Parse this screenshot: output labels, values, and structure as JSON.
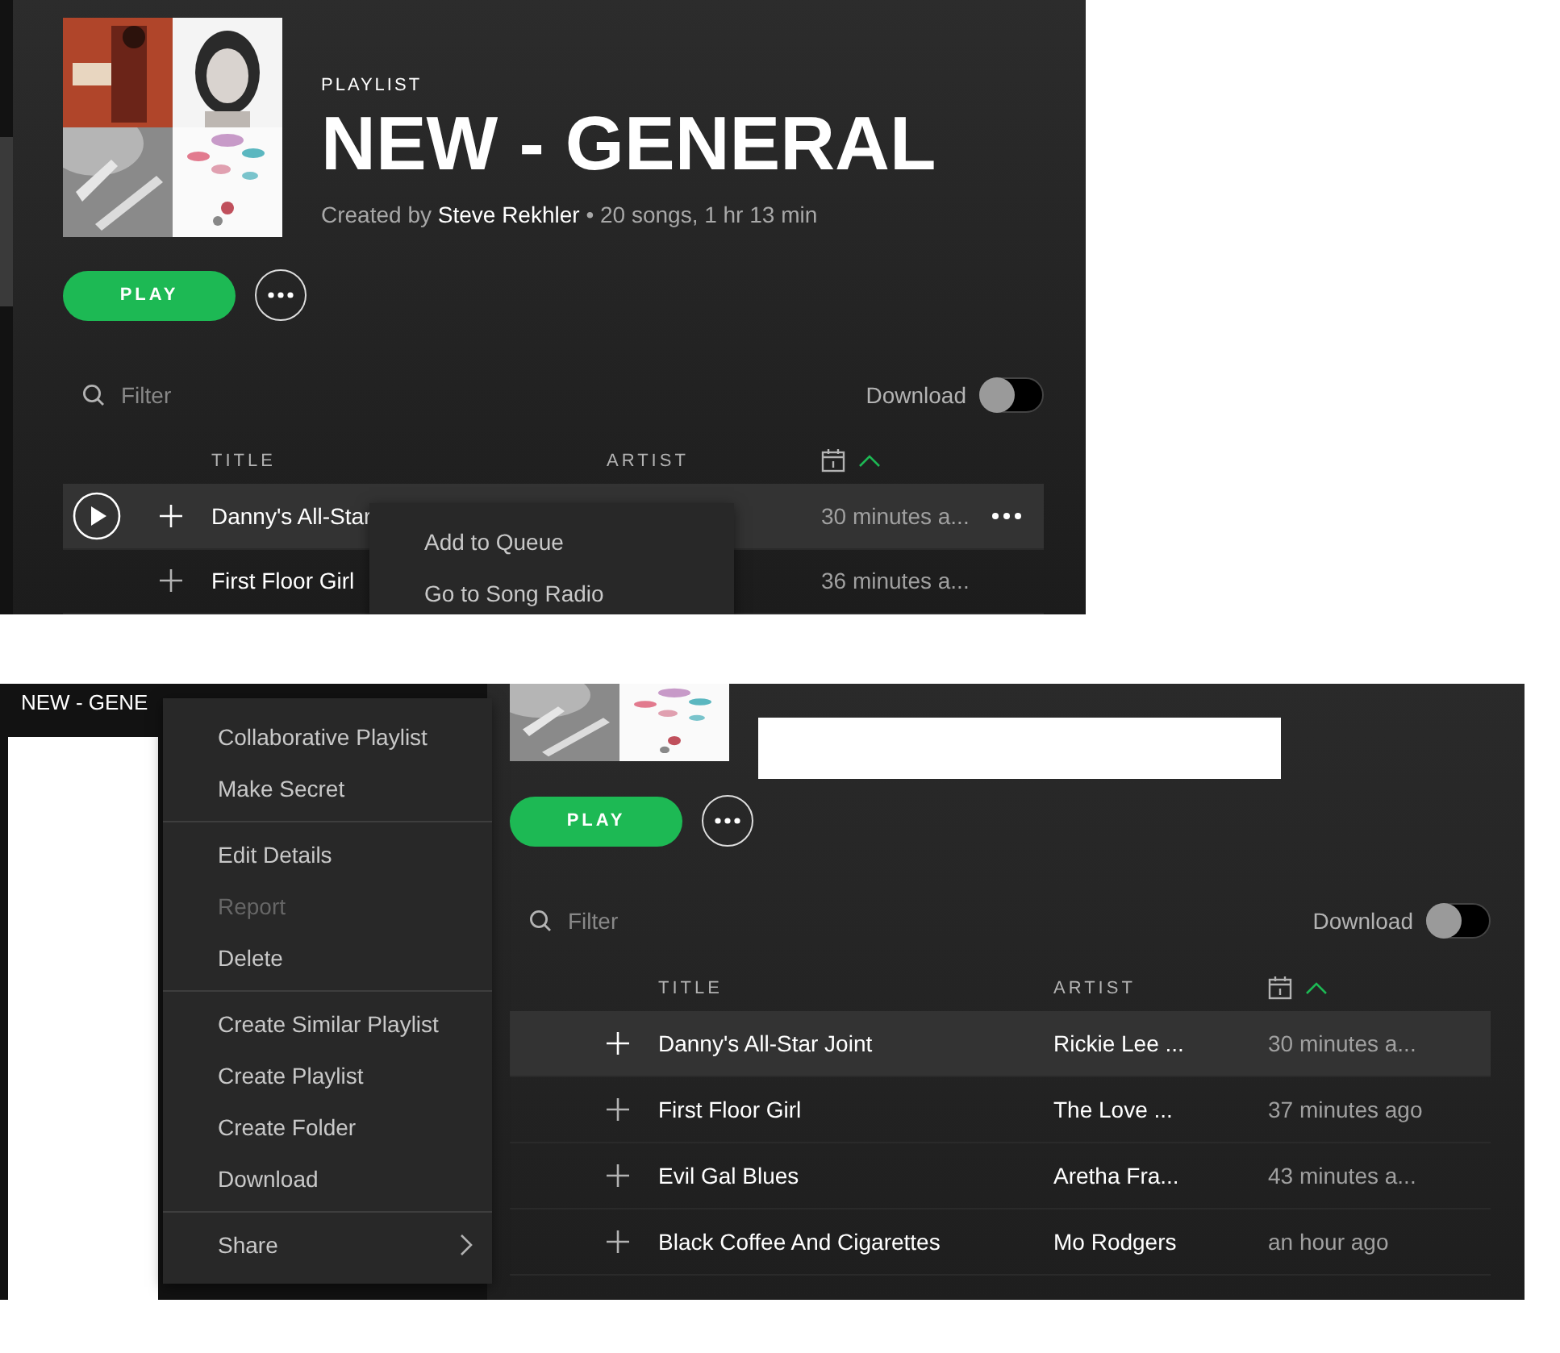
{
  "top_screenshot": {
    "header": {
      "type_label": "PLAYLIST",
      "title": "NEW - GENERAL",
      "meta": "Created by **Steve Rekhler** • 20 songs, 1 hr 13 min"
    },
    "play_button": "PLAY",
    "filter": {
      "placeholder": "Filter"
    },
    "download": {
      "label": "Download",
      "on": false
    },
    "columns": [
      "TITLE",
      "ARTIST"
    ],
    "rows": [
      {
        "title": "Danny's All-Star",
        "added": "30 minutes a...",
        "selected": true,
        "hover_controls": true
      },
      {
        "title": "First Floor Girl",
        "added": "36 minutes a...",
        "selected": false,
        "hover_controls": false
      }
    ],
    "context_menu": {
      "sections": [
        [
          {
            "label": "Add to Queue",
            "disabled": false
          },
          {
            "label": "Go to Song Radio",
            "disabled": false
          }
        ]
      ]
    }
  },
  "bottom_screenshot": {
    "sidebar": {
      "playlist_label": "NEW - GENE"
    },
    "play_button": "PLAY",
    "filter": {
      "placeholder": "Filter"
    },
    "download": {
      "label": "Download",
      "on": false
    },
    "columns": [
      "TITLE",
      "ARTIST"
    ],
    "rows": [
      {
        "title": "Danny's All-Star Joint",
        "artist": "Rickie Lee ...",
        "added": "30 minutes a...",
        "selected": true,
        "hover_controls": false
      },
      {
        "title": "First Floor Girl",
        "artist": "The Love ...",
        "added": "37 minutes ago",
        "selected": false,
        "hover_controls": false
      },
      {
        "title": "Evil Gal Blues",
        "artist": "Aretha Fra...",
        "added": "43 minutes a...",
        "selected": false,
        "hover_controls": false
      },
      {
        "title": "Black Coffee And Cigarettes",
        "artist": "Mo Rodgers",
        "added": "an hour ago",
        "selected": false,
        "hover_controls": false
      }
    ],
    "context_menu": {
      "sections": [
        [
          {
            "label": "Collaborative Playlist",
            "disabled": false
          },
          {
            "label": "Make Secret",
            "disabled": false
          }
        ],
        [
          {
            "label": "Edit Details",
            "disabled": false
          },
          {
            "label": "Report",
            "disabled": true
          },
          {
            "label": "Delete",
            "disabled": false
          }
        ],
        [
          {
            "label": "Create Similar Playlist",
            "disabled": false
          },
          {
            "label": "Create Playlist",
            "disabled": false
          },
          {
            "label": "Create Folder",
            "disabled": false
          },
          {
            "label": "Download",
            "disabled": false
          }
        ],
        [
          {
            "label": "Share",
            "disabled": false,
            "submenu": true
          }
        ]
      ]
    }
  }
}
